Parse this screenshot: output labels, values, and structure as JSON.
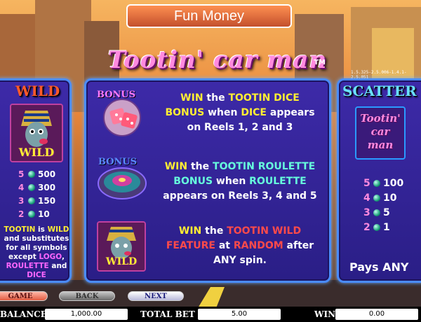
{
  "header": {
    "fun_money": "Fun Money",
    "title": "Tootin' car man",
    "tm": "TM",
    "version": "1.5.325-2.5.006-1.4.1-2.5.051"
  },
  "wild_panel": {
    "heading": "WILD",
    "symbol_label": "WILD",
    "paytable": [
      {
        "count": "5",
        "value": "500"
      },
      {
        "count": "4",
        "value": "300"
      },
      {
        "count": "3",
        "value": "150"
      },
      {
        "count": "2",
        "value": "10"
      }
    ],
    "desc": {
      "p1": "TOOTIN",
      "p2": " is ",
      "p3": "WILD",
      "p4": " and substitutes for all symbols except ",
      "p5": "LOGO",
      "p6": ", ",
      "p7": "ROULETTE",
      "p8": " and ",
      "p9": "DICE"
    }
  },
  "center_panel": {
    "bonus1": {
      "label": "BONUS",
      "w1": "WIN",
      "w2": " the ",
      "w3": "TOOTIN DICE",
      "w4": "BONUS",
      "w5": " when ",
      "w6": "DICE",
      "w7": " appears",
      "w8": "on Reels 1, 2 and 3"
    },
    "bonus2": {
      "label": "BONUS",
      "w1": "WIN",
      "w2": " the ",
      "w3": "TOOTIN ROULETTE",
      "w4": "BONUS",
      "w5": " when ",
      "w6": "ROULETTE",
      "w7": "appears on Reels 3, 4 and 5"
    },
    "wild_feature": {
      "label": "WILD",
      "w1": "WIN",
      "w2": " the ",
      "w3": "TOOTIN WILD",
      "w4": "FEATURE",
      "w5": " at ",
      "w6": "RANDOM",
      "w7": " after",
      "w8": "ANY spin."
    }
  },
  "scatter_panel": {
    "heading": "SCATTER",
    "logo_text": "Tootin' car man",
    "paytable": [
      {
        "count": "5",
        "value": "100"
      },
      {
        "count": "4",
        "value": "10"
      },
      {
        "count": "3",
        "value": "5"
      },
      {
        "count": "2",
        "value": "1"
      }
    ],
    "pays_any": "Pays ANY"
  },
  "buttons": {
    "game": "GAME",
    "back": "BACK",
    "next": "NEXT"
  },
  "status": {
    "balance_label": "BALANCE",
    "balance_value": "1,000.00",
    "total_bet_label": "TOTAL BET",
    "total_bet_value": "5.00",
    "win_label": "WIN",
    "win_value": "0.00"
  }
}
